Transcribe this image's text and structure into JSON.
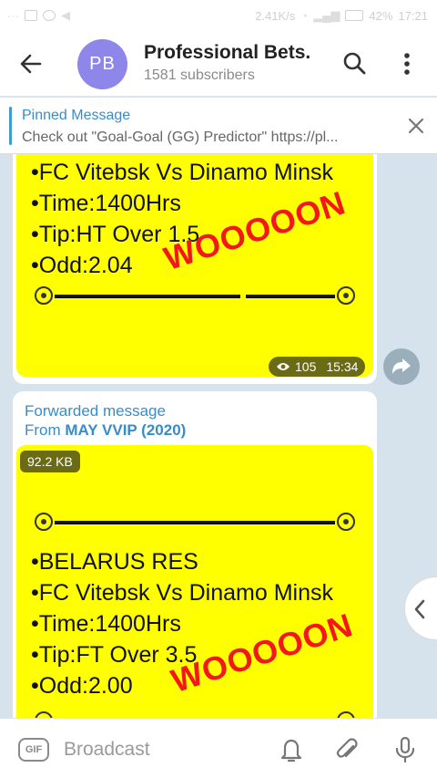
{
  "statusbar": {
    "network_speed": "2.41K/s",
    "battery": "42%",
    "time": "17:21"
  },
  "header": {
    "avatar_initials": "PB",
    "title": "Professional Bets.",
    "subtitle": "1581 subscribers"
  },
  "pinned": {
    "title": "Pinned Message",
    "text": "Check out \"Goal-Goal (GG) Predictor\" https://pl..."
  },
  "message1": {
    "lines": [
      "•FC Vitebsk Vs Dinamo Minsk",
      "•Time:1400Hrs",
      "•Tip:HT Over 1.5",
      "•Odd:2.04"
    ],
    "stamp": "WOOOOON",
    "views": "105",
    "time": "15:34"
  },
  "message2": {
    "forwarded_label": "Forwarded message",
    "from_prefix": "From ",
    "from_name": "MAY VVIP (2020)",
    "file_size": "92.2 KB",
    "lines": [
      "•BELARUS RES",
      "•FC Vitebsk Vs Dinamo Minsk",
      "•Time:1400Hrs",
      "•Tip:FT Over 3.5",
      "•Odd:2.00"
    ],
    "stamp": "WOOOOON"
  },
  "bottombar": {
    "gif_label": "GIF",
    "placeholder": "Broadcast"
  },
  "colors": {
    "accent": "#3a8cc7",
    "avatar": "#8e86e8",
    "highlight": "#ffff00",
    "stamp": "#f2181a"
  }
}
